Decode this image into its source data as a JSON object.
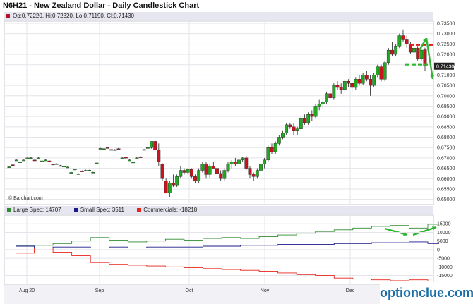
{
  "title": "N6H21 - New Zealand Dollar - Daily Candlestick Chart",
  "ohlc_label": "Op:0.72220, Hi:0.72320, Lo:0.71190, Cl:0.71430",
  "copyright": "© Barchart.com",
  "watermark": "optionclue.com",
  "colors": {
    "up": "#22a822",
    "down": "#c8141e",
    "large": "#2e8b2e",
    "small": "#1a1a8c",
    "comm": "#e8231b",
    "arrow": "#2fb52f",
    "dash": "#e01b1b"
  },
  "chart_data": [
    {
      "type": "candlestick",
      "ylim": [
        0.6475,
        0.736
      ],
      "yticks": [
        "0.73500",
        "0.73000",
        "0.72500",
        "0.72000",
        "0.71500",
        "0.71000",
        "0.70500",
        "0.70000",
        "0.69500",
        "0.69000",
        "0.68500",
        "0.68000",
        "0.67500",
        "0.67000",
        "0.66500",
        "0.66000",
        "0.65500",
        "0.65000"
      ],
      "xticks": [
        {
          "label": "Aug 20",
          "x": 38
        },
        {
          "label": "Sep",
          "x": 141
        },
        {
          "label": "Oct",
          "x": 268
        },
        {
          "label": "Nov",
          "x": 375
        },
        {
          "label": "Dec",
          "x": 496
        }
      ],
      "last_value": "0.71430",
      "candles": [
        [
          0.6657,
          0.6661,
          0.6654,
          0.6657
        ],
        [
          0.6667,
          0.6668,
          0.6662,
          0.6665
        ],
        [
          0.669,
          0.6692,
          0.6686,
          0.669
        ],
        [
          0.6681,
          0.6684,
          0.6678,
          0.6681
        ],
        [
          0.669,
          0.6692,
          0.6687,
          0.669
        ],
        [
          0.67,
          0.6702,
          0.6698,
          0.67
        ],
        [
          0.67,
          0.6703,
          0.6697,
          0.6701
        ],
        [
          0.669,
          0.6692,
          0.6687,
          0.6689
        ],
        [
          0.67,
          0.6703,
          0.6698,
          0.67
        ],
        [
          0.6686,
          0.6689,
          0.6683,
          0.6686
        ],
        [
          0.669,
          0.6693,
          0.6688,
          0.669
        ],
        [
          0.6686,
          0.6688,
          0.6682,
          0.6685
        ],
        [
          0.667,
          0.6672,
          0.6667,
          0.6669
        ],
        [
          0.6672,
          0.6674,
          0.6669,
          0.6672
        ],
        [
          0.6663,
          0.6666,
          0.666,
          0.6662
        ],
        [
          0.666,
          0.6663,
          0.6657,
          0.666
        ],
        [
          0.6655,
          0.6658,
          0.6653,
          0.6656
        ],
        [
          0.663,
          0.6633,
          0.6627,
          0.663
        ],
        [
          0.6645,
          0.6648,
          0.6643,
          0.6646
        ],
        [
          0.6623,
          0.6626,
          0.662,
          0.6624
        ],
        [
          0.6637,
          0.664,
          0.6634,
          0.6636
        ],
        [
          0.664,
          0.6643,
          0.6637,
          0.664
        ],
        [
          0.664,
          0.6643,
          0.6638,
          0.6641
        ],
        [
          0.663,
          0.6633,
          0.6627,
          0.6631
        ],
        [
          0.6675,
          0.6677,
          0.6672,
          0.6676
        ],
        [
          0.6746,
          0.6749,
          0.6744,
          0.6746
        ],
        [
          0.6745,
          0.6748,
          0.6742,
          0.6745
        ],
        [
          0.675,
          0.6752,
          0.6747,
          0.6749
        ],
        [
          0.674,
          0.6742,
          0.6737,
          0.6741
        ],
        [
          0.674,
          0.6743,
          0.6738,
          0.674
        ],
        [
          0.6745,
          0.6748,
          0.6742,
          0.6744
        ],
        [
          0.67,
          0.6703,
          0.6697,
          0.67
        ],
        [
          0.6703,
          0.6706,
          0.67,
          0.6702
        ],
        [
          0.669,
          0.6693,
          0.6687,
          0.669
        ],
        [
          0.668,
          0.6682,
          0.6677,
          0.668
        ],
        [
          0.67,
          0.6703,
          0.6698,
          0.67
        ],
        [
          0.6705,
          0.6708,
          0.6702,
          0.6704
        ],
        [
          0.674,
          0.6742,
          0.6737,
          0.6741
        ],
        [
          0.675,
          0.6753,
          0.6748,
          0.675
        ],
        [
          0.675,
          0.676,
          0.6745,
          0.678
        ],
        [
          0.678,
          0.679,
          0.673,
          0.674
        ],
        [
          0.674,
          0.677,
          0.666,
          0.668
        ],
        [
          0.667,
          0.6675,
          0.659,
          0.66
        ],
        [
          0.659,
          0.66,
          0.656,
          0.653
        ],
        [
          0.653,
          0.659,
          0.651,
          0.658
        ],
        [
          0.658,
          0.662,
          0.656,
          0.657
        ],
        [
          0.657,
          0.662,
          0.656,
          0.661
        ],
        [
          0.661,
          0.666,
          0.66,
          0.664
        ],
        [
          0.664,
          0.665,
          0.662,
          0.663
        ],
        [
          0.663,
          0.665,
          0.662,
          0.6645
        ],
        [
          0.6645,
          0.665,
          0.66,
          0.661
        ],
        [
          0.661,
          0.662,
          0.658,
          0.659
        ],
        [
          0.659,
          0.665,
          0.658,
          0.664
        ],
        [
          0.664,
          0.668,
          0.663,
          0.667
        ],
        [
          0.667,
          0.668,
          0.66,
          0.662
        ],
        [
          0.662,
          0.667,
          0.66,
          0.666
        ],
        [
          0.666,
          0.668,
          0.665,
          0.665
        ],
        [
          0.665,
          0.6665,
          0.661,
          0.6625
        ],
        [
          0.6625,
          0.664,
          0.659,
          0.66
        ],
        [
          0.66,
          0.665,
          0.659,
          0.664
        ],
        [
          0.664,
          0.668,
          0.663,
          0.667
        ],
        [
          0.667,
          0.669,
          0.665,
          0.668
        ],
        [
          0.668,
          0.67,
          0.666,
          0.667
        ],
        [
          0.667,
          0.669,
          0.666,
          0.669
        ],
        [
          0.669,
          0.6705,
          0.668,
          0.67
        ],
        [
          0.67,
          0.671,
          0.664,
          0.665
        ],
        [
          0.665,
          0.666,
          0.66,
          0.662
        ],
        [
          0.662,
          0.663,
          0.659,
          0.661
        ],
        [
          0.661,
          0.665,
          0.66,
          0.664
        ],
        [
          0.664,
          0.668,
          0.663,
          0.667
        ],
        [
          0.667,
          0.67,
          0.665,
          0.669
        ],
        [
          0.669,
          0.676,
          0.668,
          0.675
        ],
        [
          0.675,
          0.677,
          0.672,
          0.673
        ],
        [
          0.673,
          0.678,
          0.672,
          0.677
        ],
        [
          0.677,
          0.681,
          0.676,
          0.68
        ],
        [
          0.68,
          0.683,
          0.679,
          0.682
        ],
        [
          0.682,
          0.687,
          0.681,
          0.686
        ],
        [
          0.686,
          0.687,
          0.684,
          0.685
        ],
        [
          0.685,
          0.687,
          0.681,
          0.683
        ],
        [
          0.683,
          0.685,
          0.681,
          0.684
        ],
        [
          0.684,
          0.69,
          0.683,
          0.689
        ],
        [
          0.689,
          0.691,
          0.686,
          0.687
        ],
        [
          0.687,
          0.692,
          0.686,
          0.691
        ],
        [
          0.691,
          0.693,
          0.688,
          0.69
        ],
        [
          0.69,
          0.696,
          0.689,
          0.695
        ],
        [
          0.695,
          0.698,
          0.693,
          0.696
        ],
        [
          0.696,
          0.699,
          0.694,
          0.697
        ],
        [
          0.697,
          0.702,
          0.696,
          0.701
        ],
        [
          0.701,
          0.703,
          0.698,
          0.699
        ],
        [
          0.699,
          0.706,
          0.698,
          0.705
        ],
        [
          0.705,
          0.707,
          0.703,
          0.704
        ],
        [
          0.704,
          0.706,
          0.701,
          0.703
        ],
        [
          0.703,
          0.708,
          0.702,
          0.707
        ],
        [
          0.707,
          0.708,
          0.704,
          0.706
        ],
        [
          0.706,
          0.707,
          0.702,
          0.704
        ],
        [
          0.704,
          0.709,
          0.703,
          0.708
        ],
        [
          0.708,
          0.71,
          0.705,
          0.706
        ],
        [
          0.706,
          0.711,
          0.705,
          0.71
        ],
        [
          0.71,
          0.712,
          0.707,
          0.708
        ],
        [
          0.708,
          0.71,
          0.7,
          0.705
        ],
        [
          0.705,
          0.711,
          0.704,
          0.71
        ],
        [
          0.71,
          0.715,
          0.709,
          0.714
        ],
        [
          0.714,
          0.715,
          0.707,
          0.708
        ],
        [
          0.708,
          0.717,
          0.707,
          0.716
        ],
        [
          0.716,
          0.723,
          0.715,
          0.722
        ],
        [
          0.722,
          0.726,
          0.719,
          0.72
        ],
        [
          0.72,
          0.725,
          0.719,
          0.724
        ],
        [
          0.724,
          0.73,
          0.723,
          0.729
        ],
        [
          0.729,
          0.732,
          0.726,
          0.727
        ],
        [
          0.727,
          0.729,
          0.723,
          0.725
        ],
        [
          0.725,
          0.726,
          0.72,
          0.721
        ],
        [
          0.721,
          0.724,
          0.719,
          0.723
        ],
        [
          0.723,
          0.724,
          0.717,
          0.718
        ],
        [
          0.718,
          0.724,
          0.717,
          0.722
        ],
        [
          0.7222,
          0.7232,
          0.7119,
          0.7143
        ]
      ],
      "ohlc_order": [
        "open",
        "high",
        "low",
        "close"
      ]
    },
    {
      "type": "line",
      "title": "",
      "ylim": [
        -20500,
        20000
      ],
      "yticks": [
        "15000",
        "10000",
        "5000",
        "0",
        "-5000",
        "-10000",
        "-15000"
      ],
      "series": [
        {
          "name": "Large Spec: 14707",
          "color": "#2e8b2e",
          "values": [
            2500,
            2500,
            3500,
            5000,
            7000,
            5500,
            4500,
            5000,
            6000,
            5500,
            6500,
            7000,
            6500,
            7500,
            8500,
            9500,
            10500,
            11500,
            12500,
            13500,
            14000,
            12500,
            14707
          ]
        },
        {
          "name": "Small Spec: 3511",
          "color": "#1a1a8c",
          "values": [
            2000,
            1000,
            1500,
            1500,
            1000,
            1500,
            1000,
            1500,
            1500,
            1500,
            2000,
            2000,
            2500,
            2500,
            3000,
            3000,
            3000,
            3500,
            3500,
            4000,
            4000,
            4500,
            3511
          ]
        },
        {
          "name": "Commercials: -18218",
          "color": "#e8231b",
          "values": [
            -2000,
            1000,
            -1500,
            -3500,
            -7500,
            -8500,
            -9000,
            -9500,
            -10000,
            -10500,
            -11000,
            -11500,
            -12000,
            -12500,
            -13500,
            -14500,
            -15000,
            -16500,
            -17000,
            -17500,
            -18000,
            -17500,
            -18218
          ]
        }
      ]
    }
  ]
}
